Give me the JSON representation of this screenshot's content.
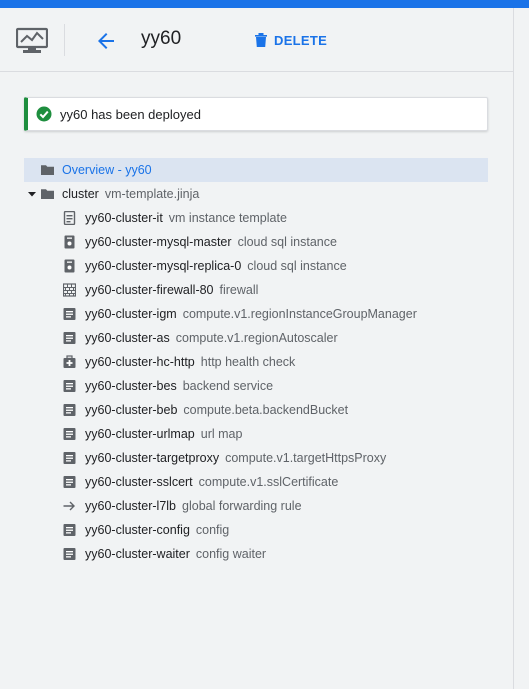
{
  "header": {
    "title": "yy60",
    "delete_label": "DELETE",
    "icon": "deployment-monitor-icon",
    "back_icon": "arrow-back-icon",
    "delete_icon": "trash-icon"
  },
  "notification": {
    "message": "yy60 has been deployed",
    "icon": "check-circle-icon",
    "status_color": "#1e8e3e"
  },
  "colors": {
    "accent": "#1a73e8",
    "selected_bg": "#dbe4f1",
    "secondary_text": "#5f6368"
  },
  "tree": {
    "overview": {
      "label": "Overview - yy60",
      "icon": "folder-icon"
    },
    "cluster": {
      "name": "cluster",
      "type": "vm-template.jinja",
      "icon": "folder-icon",
      "expanded": true
    },
    "resources": [
      {
        "name": "yy60-cluster-it",
        "type": "vm instance template",
        "icon": "template-icon"
      },
      {
        "name": "yy60-cluster-mysql-master",
        "type": "cloud sql instance",
        "icon": "sql-instance-icon"
      },
      {
        "name": "yy60-cluster-mysql-replica-0",
        "type": "cloud sql instance",
        "icon": "sql-instance-icon"
      },
      {
        "name": "yy60-cluster-firewall-80",
        "type": "firewall",
        "icon": "firewall-icon"
      },
      {
        "name": "yy60-cluster-igm",
        "type": "compute.v1.regionInstanceGroupManager",
        "icon": "document-icon"
      },
      {
        "name": "yy60-cluster-as",
        "type": "compute.v1.regionAutoscaler",
        "icon": "document-icon"
      },
      {
        "name": "yy60-cluster-hc-http",
        "type": "http health check",
        "icon": "health-check-icon"
      },
      {
        "name": "yy60-cluster-bes",
        "type": "backend service",
        "icon": "document-icon"
      },
      {
        "name": "yy60-cluster-beb",
        "type": "compute.beta.backendBucket",
        "icon": "document-icon"
      },
      {
        "name": "yy60-cluster-urlmap",
        "type": "url map",
        "icon": "document-icon"
      },
      {
        "name": "yy60-cluster-targetproxy",
        "type": "compute.v1.targetHttpsProxy",
        "icon": "document-icon"
      },
      {
        "name": "yy60-cluster-sslcert",
        "type": "compute.v1.sslCertificate",
        "icon": "document-icon"
      },
      {
        "name": "yy60-cluster-l7lb",
        "type": "global forwarding rule",
        "icon": "arrow-right-icon"
      },
      {
        "name": "yy60-cluster-config",
        "type": "config",
        "icon": "document-icon"
      },
      {
        "name": "yy60-cluster-waiter",
        "type": "config waiter",
        "icon": "document-icon"
      }
    ]
  }
}
